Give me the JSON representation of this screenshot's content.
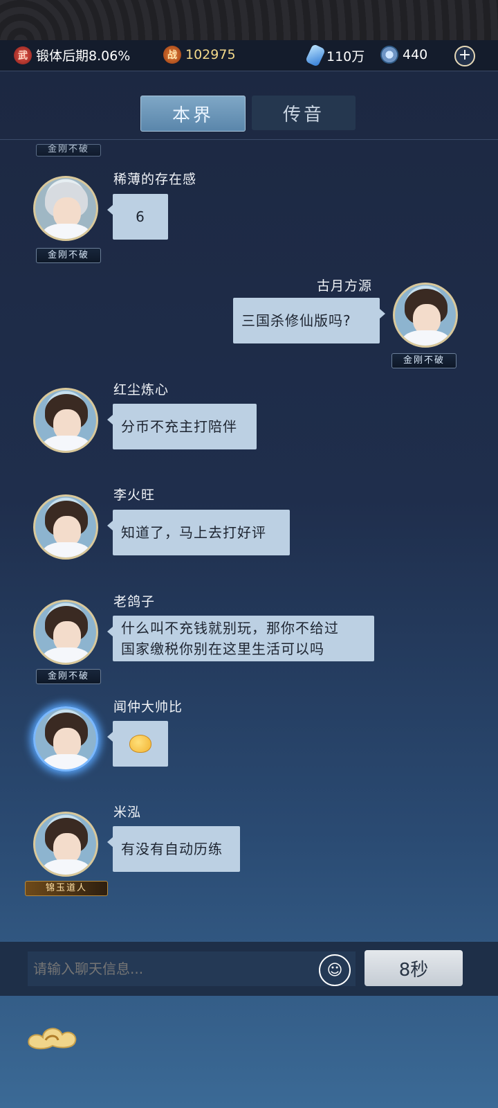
{
  "resources": {
    "cultivation_icon": "武",
    "cultivation": "锻体后期8.06%",
    "power_icon": "战",
    "power": "102975",
    "spirit_stones": "110万",
    "coins": "440",
    "plus": "+"
  },
  "tabs": [
    {
      "label": "本界",
      "active": true
    },
    {
      "label": "传音",
      "active": false
    }
  ],
  "partial_badge": "金刚不破",
  "messages": [
    {
      "name": "稀薄的存在感",
      "text": "6",
      "side": "left",
      "badge": "金刚不破"
    },
    {
      "name": "古月方源",
      "text": "三国杀修仙版吗?",
      "side": "right",
      "badge": "金刚不破"
    },
    {
      "name": "红尘炼心",
      "text": "分币不充主打陪伴",
      "side": "left",
      "badge": ""
    },
    {
      "name": "李火旺",
      "text": "知道了，马上去打好评",
      "side": "left",
      "badge": ""
    },
    {
      "name": "老鸽子",
      "text_line1": "什么叫不充钱就别玩，那你不给过",
      "text_line2": "国家缴税你别在这里生活可以吗",
      "side": "left",
      "badge": "金刚不破"
    },
    {
      "name": "闻仲大帅比",
      "text": "",
      "emoji": "chick-emoji",
      "side": "left",
      "badge": ""
    },
    {
      "name": "米泓",
      "text": "有没有自动历练",
      "side": "left",
      "badge": "锦玉道人"
    }
  ],
  "input": {
    "placeholder": "请输入聊天信息...",
    "emoji_glyph": "☺",
    "cooldown": "8秒"
  }
}
